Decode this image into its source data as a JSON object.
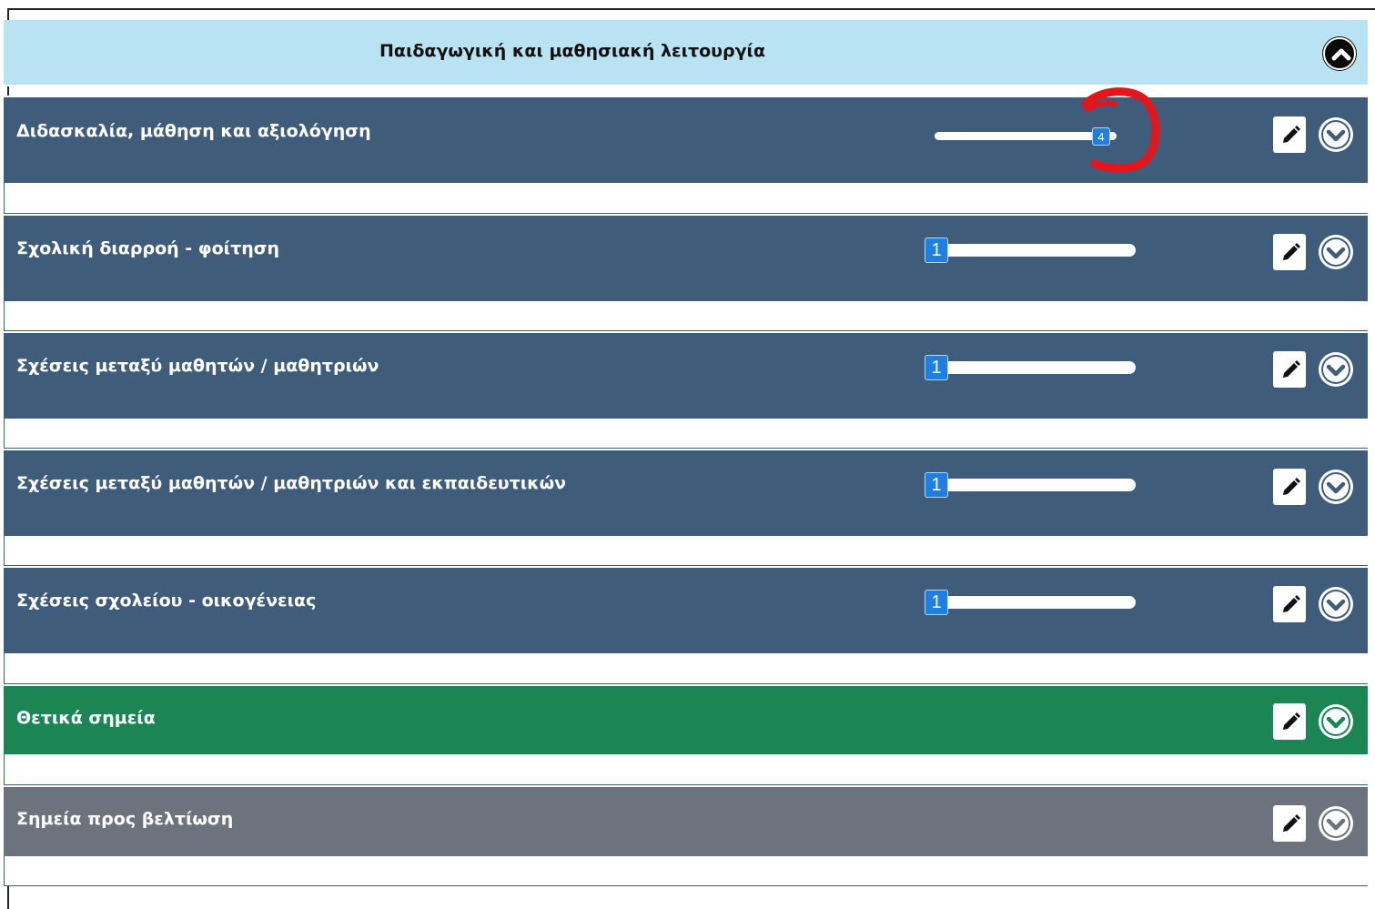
{
  "header": {
    "title": "Παιδαγωγική και μαθησιακή λειτουργία",
    "collapse_icon": "chevron-up-icon"
  },
  "rows": [
    {
      "label": "Διδασκαλία, μάθηση και αξιολόγηση",
      "slider_value": "4",
      "slider_position": "max",
      "color": "#3f5d7b"
    },
    {
      "label": "Σχολική διαρροή - φοίτηση",
      "slider_value": "1",
      "slider_position": "min",
      "color": "#3f5d7b"
    },
    {
      "label": "Σχέσεις μεταξύ μαθητών / μαθητριών",
      "slider_value": "1",
      "slider_position": "min",
      "color": "#3f5d7b"
    },
    {
      "label": "Σχέσεις μεταξύ μαθητών / μαθητριών και εκπαιδευτικών",
      "slider_value": "1",
      "slider_position": "min",
      "color": "#3f5d7b"
    },
    {
      "label": "Σχέσεις σχολείου - οικογένειας",
      "slider_value": "1",
      "slider_position": "min",
      "color": "#3f5d7b"
    },
    {
      "label": "Θετικά σημεία",
      "color": "#1b8653"
    },
    {
      "label": "Σημεία προς βελτίωση",
      "color": "#6d737d"
    }
  ],
  "row_icons": {
    "edit": "pencil-icon",
    "expand": "chevron-down-icon"
  },
  "annotation_color": "#e3161b"
}
